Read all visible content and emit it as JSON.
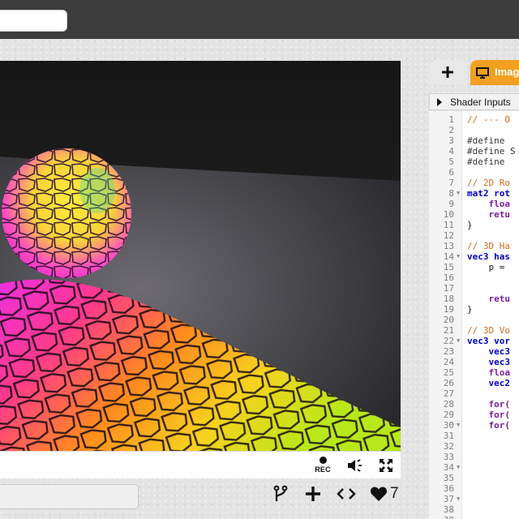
{
  "header": {
    "search_value": ""
  },
  "viewer": {
    "controls": {
      "rec_label": "REC"
    }
  },
  "shader": {
    "title_value": "",
    "likes": "7"
  },
  "editor": {
    "tabs": [
      {
        "label": "+"
      },
      {
        "label": "Imag"
      }
    ],
    "inputs_label": "Shader Inputs",
    "lines": [
      {
        "n": "1",
        "code": "// --- O",
        "kind": "comment",
        "fold": false
      },
      {
        "n": "2",
        "code": "",
        "kind": "text",
        "fold": false
      },
      {
        "n": "3",
        "code": "#define ",
        "kind": "define",
        "fold": false
      },
      {
        "n": "4",
        "code": "#define S",
        "kind": "define",
        "fold": false
      },
      {
        "n": "5",
        "code": "#define ",
        "kind": "define",
        "fold": false
      },
      {
        "n": "6",
        "code": "",
        "kind": "text",
        "fold": false
      },
      {
        "n": "7",
        "code": "// 2D Ro",
        "kind": "comment",
        "fold": false
      },
      {
        "n": "8",
        "code": "mat2 rot",
        "kind": "type",
        "fold": true
      },
      {
        "n": "9",
        "code": "    floa",
        "kind": "kw",
        "fold": false
      },
      {
        "n": "10",
        "code": "    retu",
        "kind": "kw",
        "fold": false
      },
      {
        "n": "11",
        "code": "}",
        "kind": "text",
        "fold": false
      },
      {
        "n": "12",
        "code": "",
        "kind": "text",
        "fold": false
      },
      {
        "n": "13",
        "code": "// 3D Ha",
        "kind": "comment",
        "fold": false
      },
      {
        "n": "14",
        "code": "vec3 has",
        "kind": "type",
        "fold": true
      },
      {
        "n": "15",
        "code": "    p = ",
        "kind": "text",
        "fold": false
      },
      {
        "n": "16",
        "code": "",
        "kind": "text",
        "fold": false
      },
      {
        "n": "17",
        "code": "",
        "kind": "text",
        "fold": false
      },
      {
        "n": "18",
        "code": "    retu",
        "kind": "kw",
        "fold": false
      },
      {
        "n": "19",
        "code": "}",
        "kind": "text",
        "fold": false
      },
      {
        "n": "20",
        "code": "",
        "kind": "text",
        "fold": false
      },
      {
        "n": "21",
        "code": "// 3D Vo",
        "kind": "comment",
        "fold": false
      },
      {
        "n": "22",
        "code": "vec3 vor",
        "kind": "type",
        "fold": true
      },
      {
        "n": "23",
        "code": "    vec3",
        "kind": "type",
        "fold": false
      },
      {
        "n": "24",
        "code": "    vec3",
        "kind": "type",
        "fold": false
      },
      {
        "n": "25",
        "code": "    floa",
        "kind": "kw",
        "fold": false
      },
      {
        "n": "26",
        "code": "    vec2",
        "kind": "type",
        "fold": false
      },
      {
        "n": "27",
        "code": "",
        "kind": "text",
        "fold": false
      },
      {
        "n": "28",
        "code": "    for(",
        "kind": "kw",
        "fold": false
      },
      {
        "n": "29",
        "code": "    for(",
        "kind": "kw",
        "fold": false
      },
      {
        "n": "30",
        "code": "    for(",
        "kind": "kw",
        "fold": true
      },
      {
        "n": "31",
        "code": "",
        "kind": "text",
        "fold": false
      },
      {
        "n": "32",
        "code": "",
        "kind": "text",
        "fold": false
      },
      {
        "n": "33",
        "code": "",
        "kind": "text",
        "fold": false
      },
      {
        "n": "34",
        "code": "",
        "kind": "text",
        "fold": true
      },
      {
        "n": "35",
        "code": "",
        "kind": "text",
        "fold": false
      },
      {
        "n": "36",
        "code": "",
        "kind": "text",
        "fold": false
      },
      {
        "n": "37",
        "code": "",
        "kind": "text",
        "fold": true
      },
      {
        "n": "38",
        "code": "",
        "kind": "text",
        "fold": false
      },
      {
        "n": "39",
        "code": "",
        "kind": "text",
        "fold": false
      }
    ]
  },
  "colors": {
    "accent": "#f2a020",
    "header_bg": "#3c3c3c",
    "comment": "#d2691e",
    "type": "#0000cc",
    "keyword": "#7a1ea1"
  },
  "icons": [
    "fork-icon",
    "add-icon",
    "code-icon",
    "heart-icon",
    "volume-icon",
    "fullscreen-icon",
    "monitor-icon",
    "record-icon"
  ]
}
